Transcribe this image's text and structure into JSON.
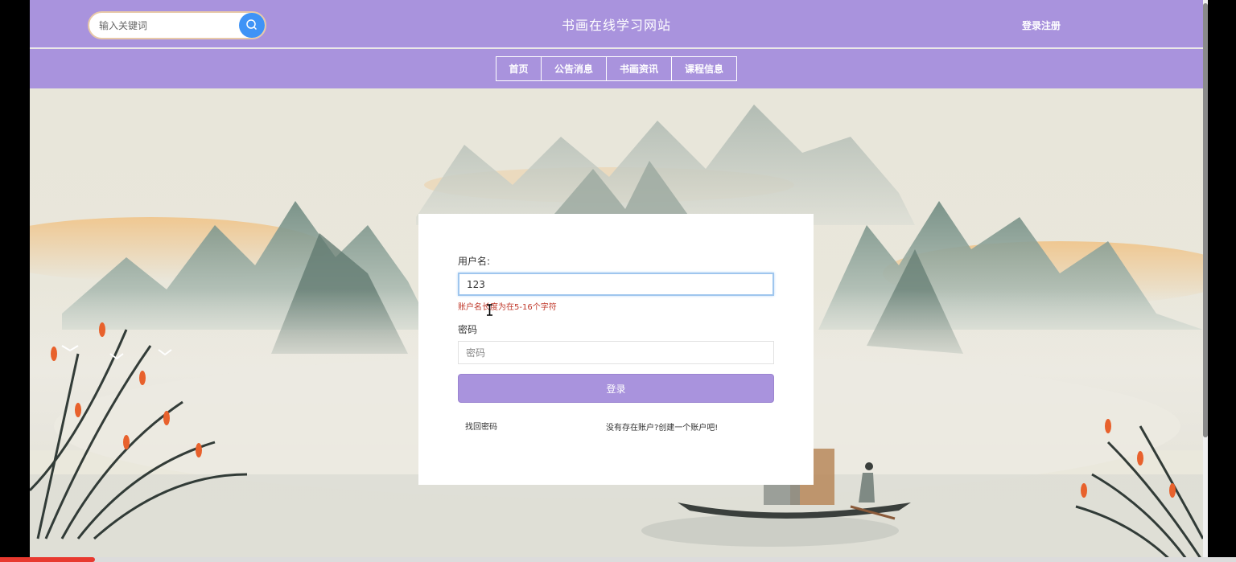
{
  "header": {
    "search_placeholder": "输入关键词",
    "site_title": "书画在线学习网站",
    "login_link": "登录注册"
  },
  "nav": {
    "items": [
      {
        "label": "首页"
      },
      {
        "label": "公告消息"
      },
      {
        "label": "书画资讯"
      },
      {
        "label": "课程信息"
      }
    ]
  },
  "login": {
    "username_label": "用户名:",
    "username_value": "123",
    "username_error": "账户名长度为在5-16个字符",
    "password_label": "密码",
    "password_placeholder": "密码",
    "submit_label": "登录",
    "forgot_label": "找回密码",
    "register_label": "没有存在账户?创建一个账户吧!"
  },
  "icons": {
    "search": "search-icon",
    "cursor": "text-cursor-icon"
  },
  "colors": {
    "header_bg": "#a993dd",
    "search_button": "#3f93f6",
    "error_text": "#c0392b",
    "input_focus": "#9fc6ee"
  }
}
